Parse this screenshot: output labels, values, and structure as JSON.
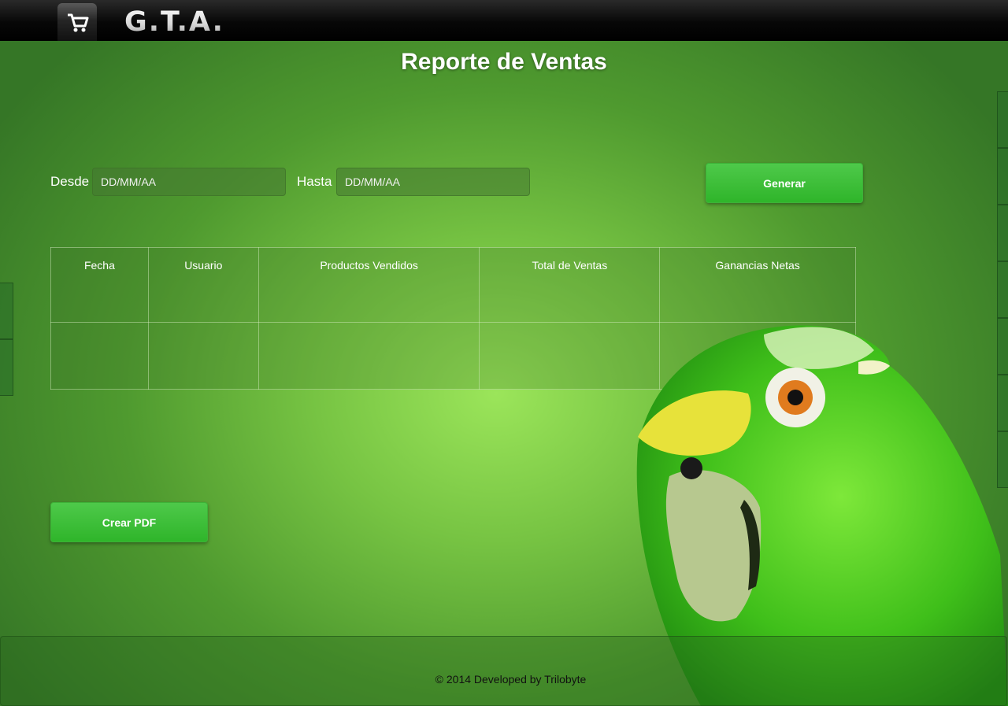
{
  "header": {
    "cart_icon": "shopping-cart-icon",
    "logo_text": "G.T.A."
  },
  "page": {
    "title": "Reporte de Ventas"
  },
  "filters": {
    "from_label": "Desde",
    "from_placeholder": "DD/MM/AA",
    "to_label": "Hasta",
    "to_placeholder": "DD/MM/AA",
    "generate_label": "Generar"
  },
  "table": {
    "columns": [
      "Fecha",
      "Usuario",
      "Productos Vendidos",
      "Total de Ventas",
      "Ganancias Netas"
    ],
    "rows": [
      [
        "",
        "",
        "",
        "",
        ""
      ]
    ]
  },
  "actions": {
    "pdf_label": "Crear PDF"
  },
  "footer": {
    "text": "© 2014 Developed by Trilobyte"
  },
  "colors": {
    "button_green": "#2fb52a",
    "background_green": "#77c443",
    "topbar": "#000000"
  }
}
